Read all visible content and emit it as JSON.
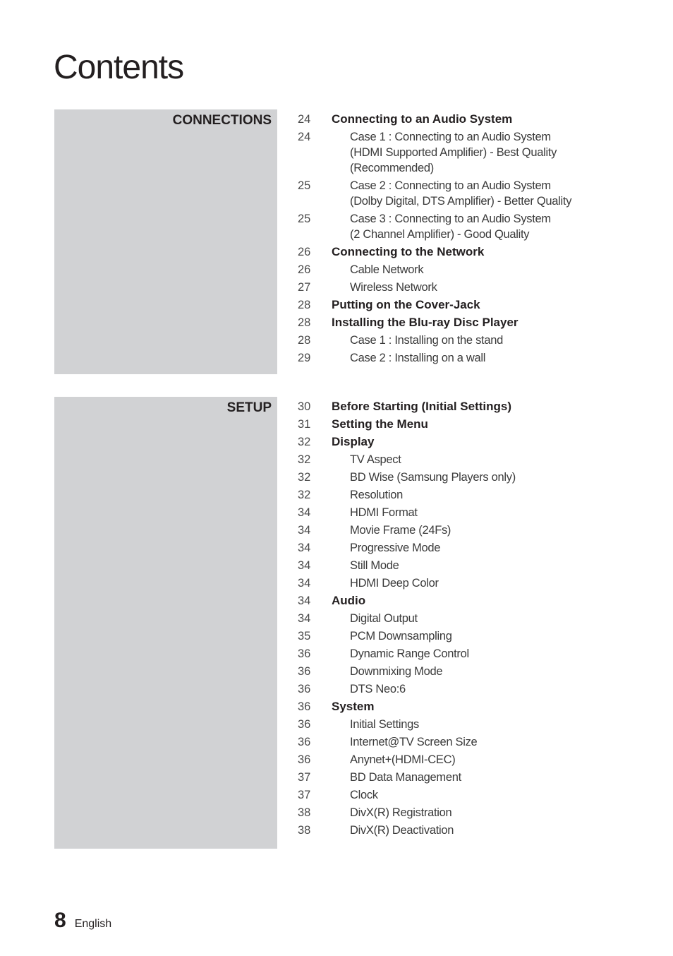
{
  "page": {
    "title": "Contents",
    "footer": {
      "page_number": "8",
      "language": "English"
    }
  },
  "sections": [
    {
      "label": "CONNECTIONS",
      "entries": [
        {
          "page": "24",
          "level": 1,
          "lines": [
            "Connecting to an Audio System"
          ]
        },
        {
          "page": "24",
          "level": 2,
          "lines": [
            "Case 1 : Connecting to an Audio System",
            "(HDMI Supported Amplifier) - Best Quality",
            "(Recommended)"
          ]
        },
        {
          "page": "25",
          "level": 2,
          "lines": [
            "Case 2 : Connecting to an Audio System",
            "(Dolby Digital, DTS Amplifier) - Better Quality"
          ]
        },
        {
          "page": "25",
          "level": 2,
          "lines": [
            "Case 3 : Connecting to an Audio System",
            "(2 Channel Amplifier) - Good Quality"
          ]
        },
        {
          "page": "26",
          "level": 1,
          "lines": [
            "Connecting to the Network"
          ]
        },
        {
          "page": "26",
          "level": 2,
          "lines": [
            "Cable Network"
          ]
        },
        {
          "page": "27",
          "level": 2,
          "lines": [
            "Wireless Network"
          ]
        },
        {
          "page": "28",
          "level": 1,
          "lines": [
            "Putting on the Cover-Jack"
          ]
        },
        {
          "page": "28",
          "level": 1,
          "lines": [
            "Installing the Blu-ray Disc Player"
          ]
        },
        {
          "page": "28",
          "level": 2,
          "lines": [
            "Case 1 : Installing on the stand"
          ]
        },
        {
          "page": "29",
          "level": 2,
          "lines": [
            "Case 2 : Installing on a wall"
          ]
        }
      ]
    },
    {
      "label": "SETUP",
      "entries": [
        {
          "page": "30",
          "level": 1,
          "lines": [
            "Before Starting (Initial Settings)"
          ]
        },
        {
          "page": "31",
          "level": 1,
          "lines": [
            "Setting the Menu"
          ]
        },
        {
          "page": "32",
          "level": 1,
          "lines": [
            "Display"
          ]
        },
        {
          "page": "32",
          "level": 2,
          "lines": [
            "TV Aspect"
          ]
        },
        {
          "page": "32",
          "level": 2,
          "lines": [
            "BD Wise (Samsung Players only)"
          ]
        },
        {
          "page": "32",
          "level": 2,
          "lines": [
            "Resolution"
          ]
        },
        {
          "page": "34",
          "level": 2,
          "lines": [
            "HDMI Format"
          ]
        },
        {
          "page": "34",
          "level": 2,
          "lines": [
            "Movie Frame (24Fs)"
          ]
        },
        {
          "page": "34",
          "level": 2,
          "lines": [
            "Progressive Mode"
          ]
        },
        {
          "page": "34",
          "level": 2,
          "lines": [
            "Still Mode"
          ]
        },
        {
          "page": "34",
          "level": 2,
          "lines": [
            "HDMI Deep Color"
          ]
        },
        {
          "page": "34",
          "level": 1,
          "lines": [
            "Audio"
          ]
        },
        {
          "page": "34",
          "level": 2,
          "lines": [
            "Digital Output"
          ]
        },
        {
          "page": "35",
          "level": 2,
          "lines": [
            "PCM Downsampling"
          ]
        },
        {
          "page": "36",
          "level": 2,
          "lines": [
            "Dynamic Range Control"
          ]
        },
        {
          "page": "36",
          "level": 2,
          "lines": [
            "Downmixing Mode"
          ]
        },
        {
          "page": "36",
          "level": 2,
          "lines": [
            "DTS Neo:6"
          ]
        },
        {
          "page": "36",
          "level": 1,
          "lines": [
            "System"
          ]
        },
        {
          "page": "36",
          "level": 2,
          "lines": [
            "Initial Settings"
          ]
        },
        {
          "page": "36",
          "level": 2,
          "lines": [
            "Internet@TV Screen Size"
          ]
        },
        {
          "page": "36",
          "level": 2,
          "lines": [
            "Anynet+(HDMI-CEC)"
          ]
        },
        {
          "page": "37",
          "level": 2,
          "lines": [
            "BD Data Management"
          ]
        },
        {
          "page": "37",
          "level": 2,
          "lines": [
            "Clock"
          ]
        },
        {
          "page": "38",
          "level": 2,
          "lines": [
            "DivX(R) Registration"
          ]
        },
        {
          "page": "38",
          "level": 2,
          "lines": [
            "DivX(R) Deactivation"
          ]
        }
      ]
    }
  ],
  "colors": {
    "section_box": "#d1d2d4",
    "text": "#231f20"
  }
}
